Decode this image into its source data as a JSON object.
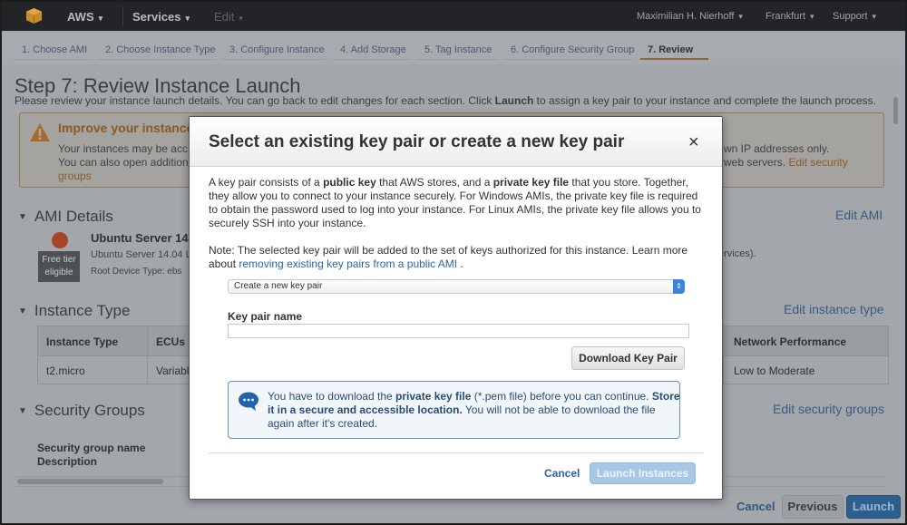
{
  "topnav": {
    "brand": "AWS",
    "services": "Services",
    "edit": "Edit",
    "user": "Maximilian H. Nierhoff",
    "region": "Frankfurt",
    "support": "Support"
  },
  "wizard": {
    "steps": [
      {
        "label": "1. Choose AMI"
      },
      {
        "label": "2. Choose Instance Type"
      },
      {
        "label": "3. Configure Instance"
      },
      {
        "label": "4. Add Storage"
      },
      {
        "label": "5. Tag Instance"
      },
      {
        "label": "6. Configure Security Group"
      },
      {
        "label": "7. Review"
      }
    ],
    "active_index": 6
  },
  "page": {
    "title": "Step 7: Review Instance Launch",
    "intro_pre": "Please review your instance launch details. You can go back to edit changes for each section. Click ",
    "intro_bold": "Launch",
    "intro_post": " to assign a key pair to your instance and complete the launch process."
  },
  "warning": {
    "title": "Improve your instance",
    "line1_left": "Your instances may be acc",
    "line1_right": "wn IP addresses only.",
    "line2_left": "You can also open addition",
    "line2_right": "web servers.",
    "link_part1": "Edit security",
    "link_part2": "groups"
  },
  "ami": {
    "section_title": "AMI Details",
    "edit_label": "Edit AMI",
    "name": "Ubuntu Server 14.",
    "desc": "Ubuntu Server 14.04 L",
    "desc_right": "ervices).",
    "root_device": "Root Device Type: ebs",
    "free_tier_line1": "Free tier",
    "free_tier_line2": "eligible"
  },
  "instance_type": {
    "section_title": "Instance Type",
    "edit_label": "Edit instance type",
    "columns": [
      "Instance Type",
      "ECUs",
      "Network Performance"
    ],
    "row": [
      "t2.micro",
      "Variabl",
      "Low to Moderate"
    ]
  },
  "security_groups": {
    "section_title": "Security Groups",
    "edit_label": "Edit security groups",
    "fields": [
      "Security group name",
      "Description"
    ]
  },
  "footer": {
    "cancel": "Cancel",
    "previous": "Previous",
    "launch": "Launch"
  },
  "modal": {
    "title": "Select an existing key pair or create a new key pair",
    "close": "×",
    "p1_line1_pre": "A key pair consists of a ",
    "p1_line1_b1": "public key",
    "p1_line1_mid": " that AWS stores, and a ",
    "p1_line1_b2": "private key file",
    "p1_line1_post": " that you store. Together,",
    "p1_line2": "they allow you to connect to your instance securely. For Windows AMIs, the private key file is required",
    "p1_line3": "to obtain the password used to log into your instance. For Linux AMIs, the private key file allows you to",
    "p1_line4": "securely SSH into your instance.",
    "note_line1": "Note: The selected key pair will be added to the set of keys authorized for this instance. Learn more",
    "note_line2_pre": "about ",
    "note_link": "removing existing key pairs from a public AMI",
    "note_line2_post": " .",
    "select_value": "Create a new key pair",
    "key_pair_label": "Key pair name",
    "key_pair_value": "",
    "download_button": "Download Key Pair",
    "info_l1_pre": "You have to download the ",
    "info_l1_b": "private key file",
    "info_l1_mid": " (*.pem file) before you can continue. ",
    "info_l1_b2": "Store",
    "info_l2_b": "it in a secure and accessible location.",
    "info_l2_post": " You will not be able to download the file",
    "info_l3": "again after it's created.",
    "cancel": "Cancel",
    "launch": "Launch Instances"
  },
  "colors": {
    "accent_blue": "#2b65a8",
    "launch_disabled": "#a6c7e6",
    "warning_orange": "#8b5a24",
    "aws_orange": "#e8a33a"
  }
}
